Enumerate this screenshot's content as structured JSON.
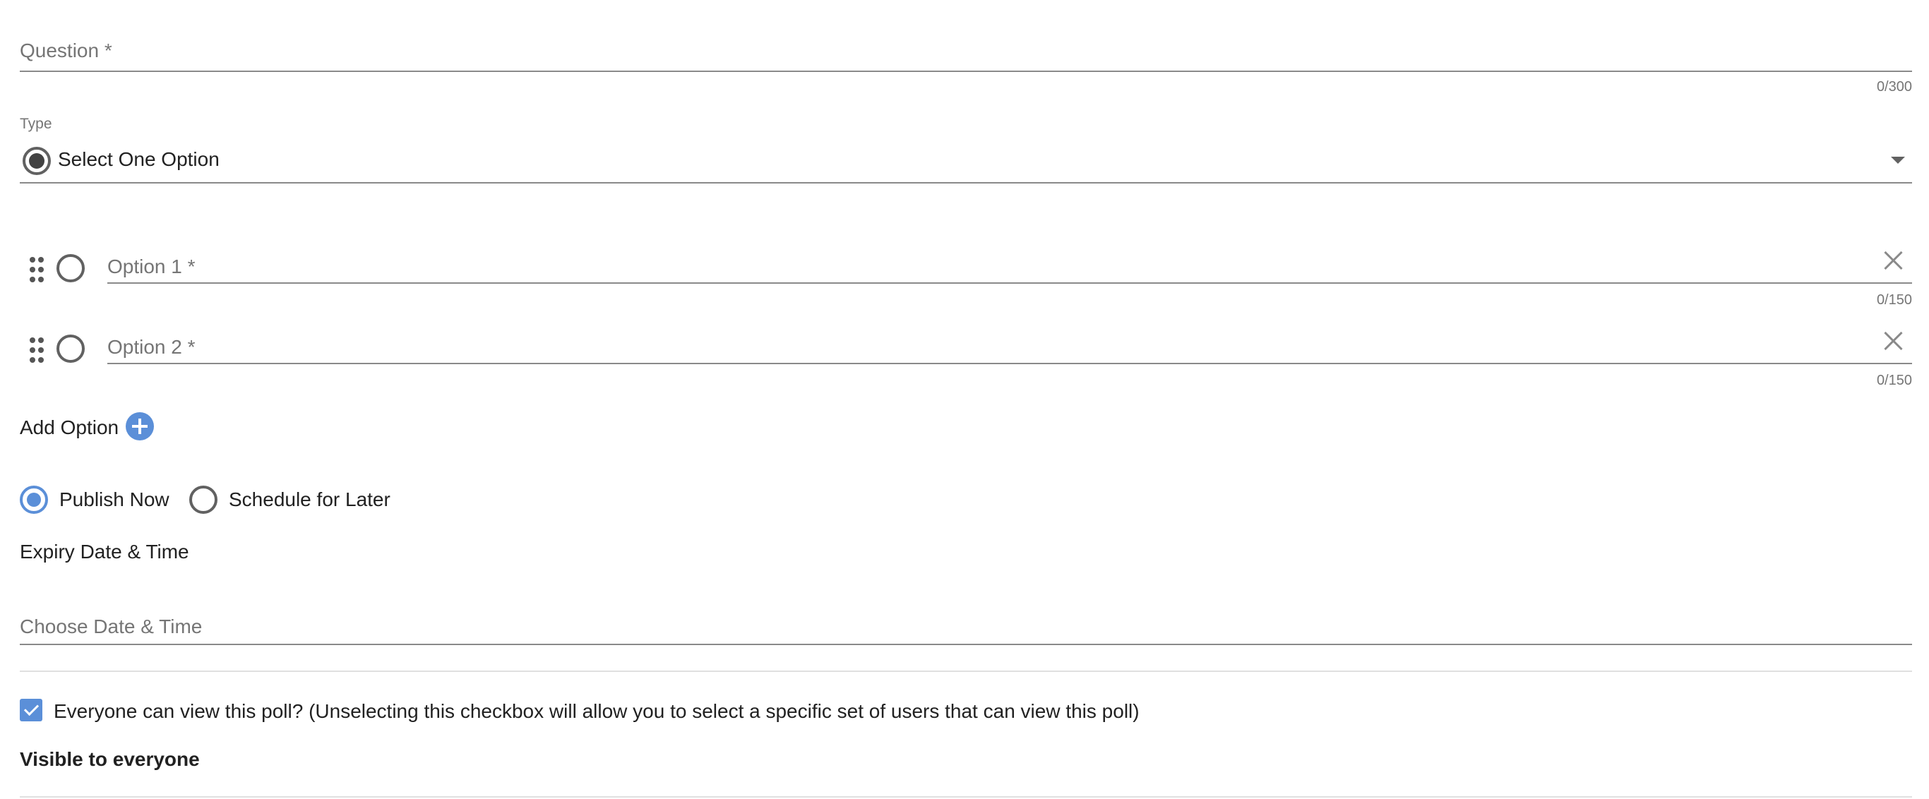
{
  "question": {
    "placeholder": "Question *",
    "counter": "0/300"
  },
  "type": {
    "label": "Type",
    "selected": "Select One Option"
  },
  "options": [
    {
      "placeholder": "Option 1 *",
      "counter": "0/150"
    },
    {
      "placeholder": "Option 2 *",
      "counter": "0/150"
    }
  ],
  "add_option": {
    "label": "Add Option"
  },
  "publish": {
    "now_label": "Publish Now",
    "later_label": "Schedule for Later",
    "selected": "Publish Now"
  },
  "expiry": {
    "label": "Expiry Date & Time",
    "placeholder": "Choose Date & Time"
  },
  "visibility": {
    "checkbox_label": "Everyone can view this poll? (Unselecting this checkbox will allow you to select a specific set of users that can view this poll)",
    "checked": true,
    "status": "Visible to everyone"
  },
  "colors": {
    "accent": "#5b8fd8",
    "line": "#8a8a8a",
    "muted": "#757575"
  }
}
